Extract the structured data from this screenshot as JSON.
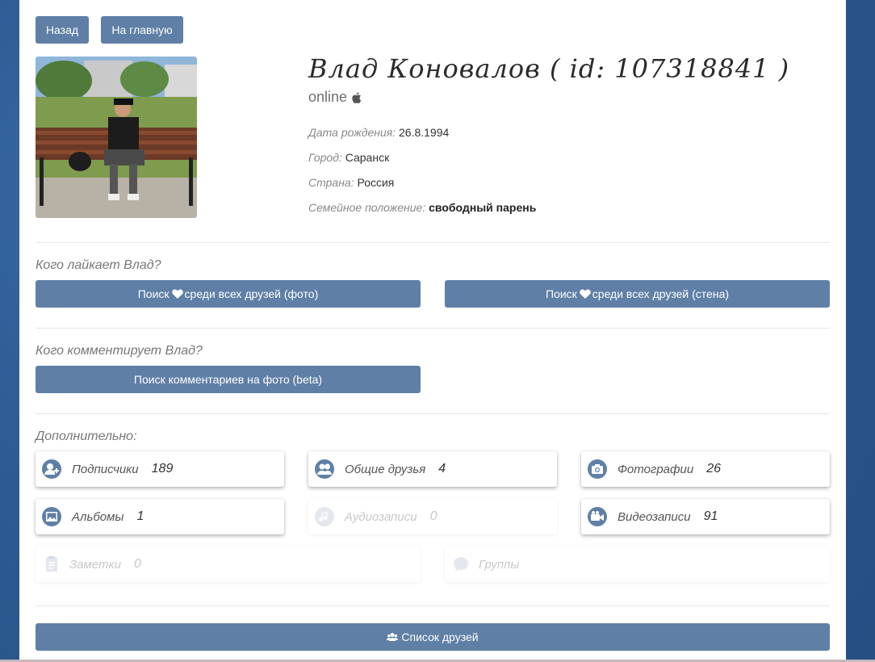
{
  "nav": {
    "back_label": "Назад",
    "home_label": "На главную"
  },
  "profile": {
    "name": "Влад Коновалов ( id: 107318841 )",
    "status": "online",
    "fields": [
      {
        "label": "Дата рождения:",
        "value": "26.8.1994"
      },
      {
        "label": "Город:",
        "value": "Саранск"
      },
      {
        "label": "Страна:",
        "value": "Россия"
      },
      {
        "label": "Семейное положение:",
        "value": "свободный парень"
      }
    ]
  },
  "likes": {
    "title": "Кого лайкает Влад?",
    "photo_btn_pre": "Поиск",
    "photo_btn_post": "среди всех друзей (фото)",
    "wall_btn_pre": "Поиск",
    "wall_btn_post": "среди всех друзей (стена)"
  },
  "comments": {
    "title": "Кого комментирует Влад?",
    "btn": "Поиск комментариев на фото (beta)"
  },
  "extra": {
    "title": "Дополнительно:",
    "items": [
      {
        "label": "Подписчики",
        "count": "189",
        "icon": "add-user-icon",
        "enabled": true
      },
      {
        "label": "Общие друзья",
        "count": "4",
        "icon": "mutual-friends-icon",
        "enabled": true
      },
      {
        "label": "Фотографии",
        "count": "26",
        "icon": "camera-icon",
        "enabled": true
      },
      {
        "label": "Альбомы",
        "count": "1",
        "icon": "album-icon",
        "enabled": true
      },
      {
        "label": "Аудиозаписи",
        "count": "0",
        "icon": "music-icon",
        "enabled": false
      },
      {
        "label": "Видеозаписи",
        "count": "91",
        "icon": "video-icon",
        "enabled": true
      },
      {
        "label": "Заметки",
        "count": "0",
        "icon": "notes-icon",
        "enabled": false
      },
      {
        "label": "Группы",
        "count": "",
        "icon": "groups-icon",
        "enabled": false
      }
    ]
  },
  "friends_btn": "Список друзей",
  "colors": {
    "button": "#5f7fa6",
    "background": "#2f5d96",
    "panel": "#ffffff"
  }
}
